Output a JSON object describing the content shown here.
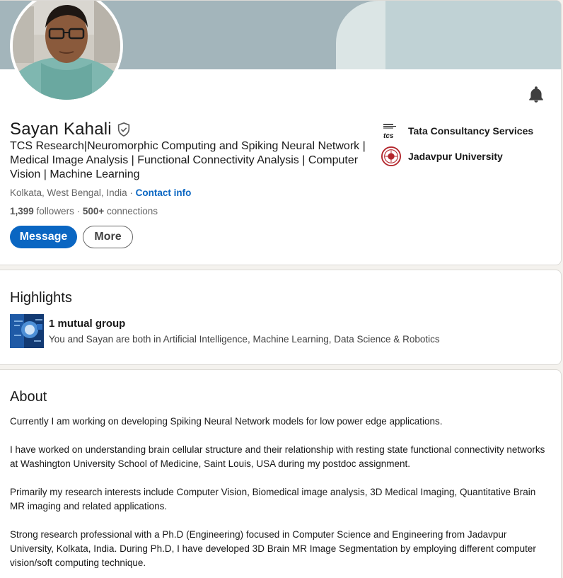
{
  "profile": {
    "name": "Sayan Kahali",
    "headline": "TCS Research|Neuromorphic Computing and Spiking Neural Network | Medical Image Analysis | Functional Connectivity Analysis | Computer Vision | Machine Learning",
    "location": "Kolkata, West Bengal, India",
    "location_separator": " · ",
    "contact_info": "Contact info",
    "followers": "1,399",
    "followers_label": " followers",
    "connections_separator": " · ",
    "connections": "500+",
    "connections_label": " connections",
    "message_button": "Message",
    "more_button": "More",
    "organizations": [
      {
        "name": "Tata Consultancy Services",
        "icon": "tcs-logo"
      },
      {
        "name": "Jadavpur University",
        "icon": "jadavpur-university-seal"
      }
    ],
    "icons": {
      "notify": "bell-icon",
      "verified": "verified-shield-icon"
    }
  },
  "highlights": {
    "title": "Highlights",
    "group_title": "1 mutual group",
    "group_desc": "You and Sayan are both in Artificial Intelligence, Machine Learning, Data Science & Robotics"
  },
  "about": {
    "title": "About",
    "paragraphs": [
      "Currently I am working on developing Spiking Neural Network models for low power edge applications.",
      "I have worked on understanding brain cellular structure and their relationship with resting state functional connectivity networks at Washington University School of Medicine, Saint Louis, USA during my postdoc assignment.",
      "Primarily my research interests include Computer Vision, Biomedical image analysis, 3D Medical Imaging, Quantitative Brain MR imaging and related applications.",
      "Strong research professional with a Ph.D (Engineering) focused in Computer Science and Engineering from Jadavpur University, Kolkata, India. During Ph.D, I have developed 3D Brain MR Image Segmentation by employing different computer vision/soft computing technique."
    ]
  },
  "colors": {
    "accent": "#0a66c2",
    "banner": "#a3b5bb",
    "page_bg": "#f4f2ee"
  }
}
